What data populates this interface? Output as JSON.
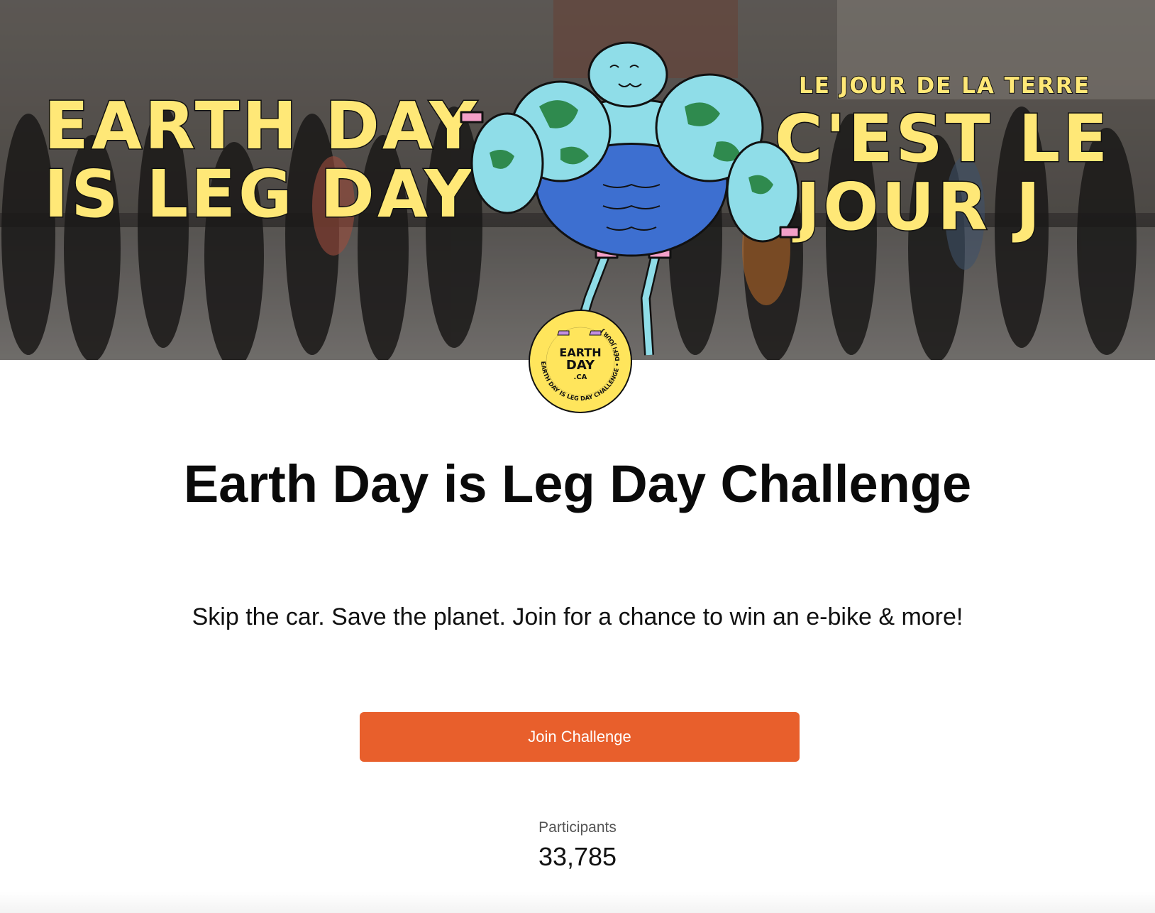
{
  "hero": {
    "headline_en_line1": "EARTH DAY",
    "headline_en_line2": "IS LEG DAY",
    "headline_fr_small": "LE JOUR DE LA TERRE",
    "headline_fr_line1": "C'EST LE",
    "headline_fr_line2": "JOUR J",
    "mascot_icon": "muscular-earth-mascot-icon"
  },
  "badge": {
    "logo_line1": "EARTH",
    "logo_line2": "DAY",
    "logo_line3": ".CA",
    "ring_text": "EARTH DAY IS LEG DAY CHALLENGE • DÉFI JOUR J"
  },
  "challenge": {
    "title": "Earth Day is Leg Day Challenge",
    "subtitle": "Skip the car. Save the planet. Join for a chance to win an e-bike & more!",
    "join_label": "Join Challenge"
  },
  "stats": {
    "participants_label": "Participants",
    "participants_value": "33,785"
  },
  "colors": {
    "accent": "#e85f2c",
    "banner_text": "#ffe877",
    "badge_yellow": "#ffe55c",
    "earth_water": "#8fdde8",
    "earth_land": "#2f8a4e",
    "singlet": "#3d6fd0"
  }
}
